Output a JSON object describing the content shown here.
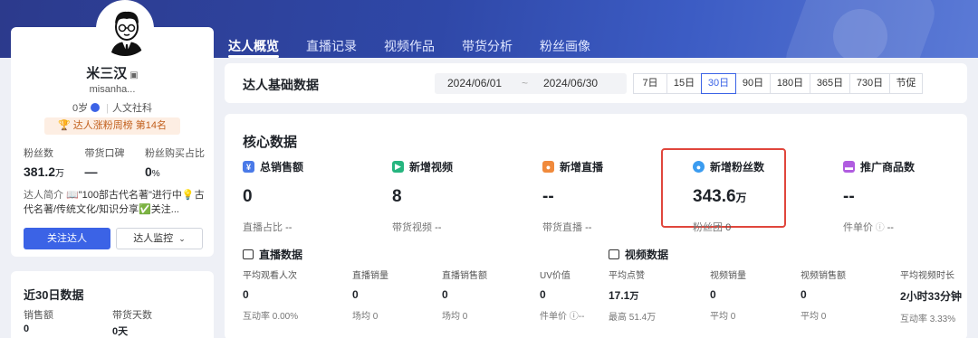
{
  "nav": {
    "tabs": [
      {
        "label": "达人概览",
        "active": true
      },
      {
        "label": "直播记录",
        "active": false
      },
      {
        "label": "视频作品",
        "active": false
      },
      {
        "label": "带货分析",
        "active": false
      },
      {
        "label": "粉丝画像",
        "active": false
      }
    ]
  },
  "profile": {
    "name": "米三汉",
    "qr_icon": "qr-code-icon",
    "handle": "misanha...",
    "age": "0岁",
    "category": "人文社科",
    "rank_text": "达人涨粉周榜 第14名",
    "stats": [
      {
        "label": "粉丝数",
        "value": "381.2",
        "unit": "万"
      },
      {
        "label": "带货口碑",
        "value": "—",
        "unit": ""
      },
      {
        "label": "粉丝购买占比",
        "value": "0",
        "unit": "%"
      }
    ],
    "intro_label": "达人简介",
    "intro_text": "📖\"100部古代名著\"进行中💡古代名著/传统文化/知识分享✅关注...",
    "follow_button": "关注达人",
    "monitor_button": "达人监控"
  },
  "recent": {
    "title": "近30日数据",
    "items": [
      {
        "label": "销售额",
        "value": "0"
      },
      {
        "label": "带货天数",
        "value": "0天"
      }
    ]
  },
  "basic": {
    "title": "达人基础数据",
    "date_start": "2024/06/01",
    "date_sep": "~",
    "date_end": "2024/06/30",
    "periods": [
      {
        "label": "7日",
        "active": false
      },
      {
        "label": "15日",
        "active": false
      },
      {
        "label": "30日",
        "active": true
      },
      {
        "label": "90日",
        "active": false
      },
      {
        "label": "180日",
        "active": false
      },
      {
        "label": "365日",
        "active": false
      },
      {
        "label": "730日",
        "active": false
      },
      {
        "label": "节促",
        "active": false
      }
    ]
  },
  "core": {
    "title": "核心数据",
    "metrics": [
      {
        "icon": "sales-icon",
        "color": "#4a7ae8",
        "label": "总销售额",
        "value": "0",
        "unit": "",
        "foot_label": "直播占比",
        "foot_value": "--"
      },
      {
        "icon": "video-icon",
        "color": "#26b57f",
        "label": "新增视频",
        "value": "8",
        "unit": "",
        "foot_label": "带货视频",
        "foot_value": "--"
      },
      {
        "icon": "live-icon",
        "color": "#f08a3c",
        "label": "新增直播",
        "value": "--",
        "unit": "",
        "foot_label": "带货直播",
        "foot_value": "--"
      },
      {
        "icon": "user-icon",
        "color": "#3b9cf0",
        "label": "新增粉丝数",
        "value": "343.6",
        "unit": "万",
        "foot_label": "粉丝团",
        "foot_value": "0"
      },
      {
        "icon": "cart-icon",
        "color": "#b05ce0",
        "label": "推广商品数",
        "value": "--",
        "unit": "",
        "foot_label": "件单价",
        "foot_value": "--"
      }
    ],
    "live": {
      "title": "直播数据",
      "items": [
        {
          "label": "平均观看人次",
          "value": "0",
          "unit": "",
          "foot": "互动率 0.00%"
        },
        {
          "label": "直播销量",
          "value": "0",
          "unit": "",
          "foot": "场均 0"
        },
        {
          "label": "直播销售额",
          "value": "0",
          "unit": "",
          "foot": "场均 0"
        },
        {
          "label": "UV价值",
          "value": "0",
          "unit": "",
          "foot": "件单价 ⓘ--"
        }
      ]
    },
    "video": {
      "title": "视频数据",
      "items": [
        {
          "label": "平均点赞",
          "value": "17.1",
          "unit": "万",
          "foot": "最高 51.4万"
        },
        {
          "label": "视频销量",
          "value": "0",
          "unit": "",
          "foot": "平均 0"
        },
        {
          "label": "视频销售额",
          "value": "0",
          "unit": "",
          "foot": "平均 0"
        },
        {
          "label": "平均视频时长",
          "value": "2小时33分钟",
          "unit": "",
          "foot": "互动率 3.33%"
        }
      ]
    }
  }
}
